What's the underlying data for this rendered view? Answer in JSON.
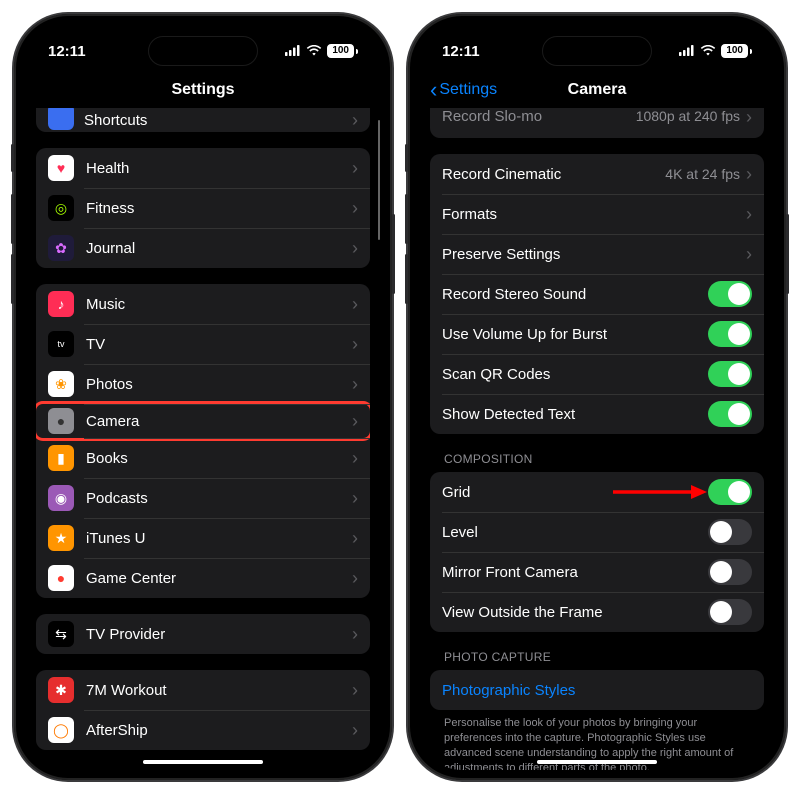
{
  "status": {
    "time": "12:11",
    "battery": "100"
  },
  "left": {
    "title": "Settings",
    "partial_top": "Shortcuts",
    "group1": [
      {
        "label": "Health",
        "icon_bg": "#ffffff",
        "icon_glyph": "♥",
        "icon_color": "#ff2d55"
      },
      {
        "label": "Fitness",
        "icon_bg": "#000000",
        "icon_glyph": "◎",
        "icon_color": "#a6ff00"
      },
      {
        "label": "Journal",
        "icon_bg": "#1f1b3a",
        "icon_glyph": "✿",
        "icon_color": "#d96bff"
      }
    ],
    "group2": [
      {
        "label": "Music",
        "icon_bg": "#ff2d55",
        "icon_glyph": "♪",
        "icon_color": "#fff"
      },
      {
        "label": "TV",
        "icon_bg": "#000000",
        "icon_glyph": "tv",
        "icon_color": "#fff",
        "small": true
      },
      {
        "label": "Photos",
        "icon_bg": "#ffffff",
        "icon_glyph": "❀",
        "icon_color": "#ff9500"
      },
      {
        "label": "Camera",
        "icon_bg": "#8e8e93",
        "icon_glyph": "●",
        "icon_color": "#333",
        "highlight": true
      },
      {
        "label": "Books",
        "icon_bg": "#ff9500",
        "icon_glyph": "▮",
        "icon_color": "#fff"
      },
      {
        "label": "Podcasts",
        "icon_bg": "#9b59b6",
        "icon_glyph": "◉",
        "icon_color": "#fff"
      },
      {
        "label": "iTunes U",
        "icon_bg": "#ff9500",
        "icon_glyph": "★",
        "icon_color": "#fff"
      },
      {
        "label": "Game Center",
        "icon_bg": "#ffffff",
        "icon_glyph": "●",
        "icon_color": "#ff3b30"
      }
    ],
    "group3": [
      {
        "label": "TV Provider",
        "icon_bg": "#000000",
        "icon_glyph": "⇆",
        "icon_color": "#fff"
      }
    ],
    "group4": [
      {
        "label": "7M Workout",
        "icon_bg": "#e62e2e",
        "icon_glyph": "✱",
        "icon_color": "#fff"
      },
      {
        "label": "AfterShip",
        "icon_bg": "#ffffff",
        "icon_glyph": "◯",
        "icon_color": "#ff7a00"
      }
    ]
  },
  "right": {
    "back": "Settings",
    "title": "Camera",
    "cut_row": {
      "label": "Record Slo-mo",
      "value": "1080p at 240 fps"
    },
    "group1": [
      {
        "label": "Record Cinematic",
        "value": "4K at 24 fps",
        "type": "nav"
      },
      {
        "label": "Formats",
        "type": "nav"
      },
      {
        "label": "Preserve Settings",
        "type": "nav"
      },
      {
        "label": "Record Stereo Sound",
        "type": "toggle",
        "on": true
      },
      {
        "label": "Use Volume Up for Burst",
        "type": "toggle",
        "on": true
      },
      {
        "label": "Scan QR Codes",
        "type": "toggle",
        "on": true
      },
      {
        "label": "Show Detected Text",
        "type": "toggle",
        "on": true
      }
    ],
    "section2_header": "Composition",
    "group2": [
      {
        "label": "Grid",
        "type": "toggle",
        "on": true,
        "arrow": true
      },
      {
        "label": "Level",
        "type": "toggle",
        "on": false
      },
      {
        "label": "Mirror Front Camera",
        "type": "toggle",
        "on": false
      },
      {
        "label": "View Outside the Frame",
        "type": "toggle",
        "on": false
      }
    ],
    "section3_header": "Photo Capture",
    "group3_link": "Photographic Styles",
    "footer": "Personalise the look of your photos by bringing your preferences into the capture. Photographic Styles use advanced scene understanding to apply the right amount of adjustments to different parts of the photo."
  }
}
